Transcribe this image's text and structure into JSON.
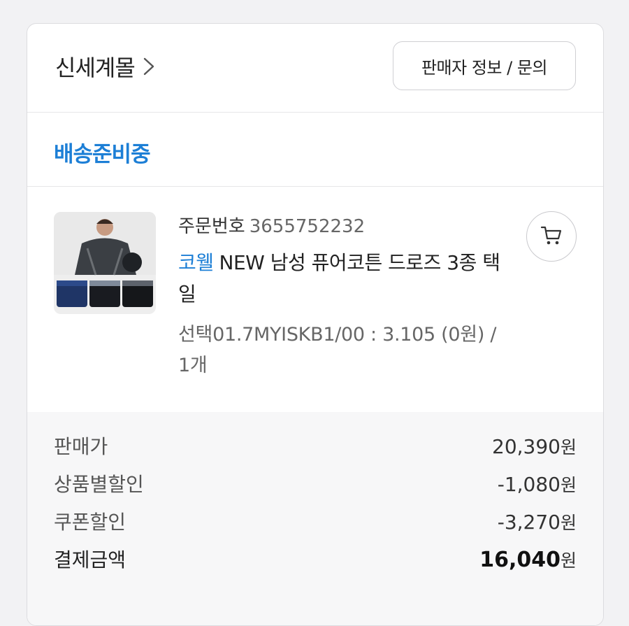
{
  "header": {
    "seller_name": "신세계몰",
    "seller_info_button": "판매자 정보 / 문의"
  },
  "status": {
    "label": "배송준비중"
  },
  "order": {
    "order_no_label": "주문번호",
    "order_no": "3655752232",
    "brand": "코웰",
    "product_name": "NEW 남성 퓨어코튼 드로즈 3종 택일",
    "option": "선택01.7MYISKB1/00 : 3.105 (0원) / 1개"
  },
  "prices": {
    "currency": "원",
    "rows": [
      {
        "label": "판매가",
        "amount": "20,390"
      },
      {
        "label": "상품별할인",
        "amount": "-1,080"
      },
      {
        "label": "쿠폰할인",
        "amount": "-3,270"
      }
    ],
    "total_label": "결제금액",
    "total_amount": "16,040"
  },
  "icons": {
    "chevron": "chevron-right-icon",
    "cart": "cart-icon"
  },
  "colors": {
    "accent": "#1d7fd6",
    "background": "#f2f2f4"
  }
}
